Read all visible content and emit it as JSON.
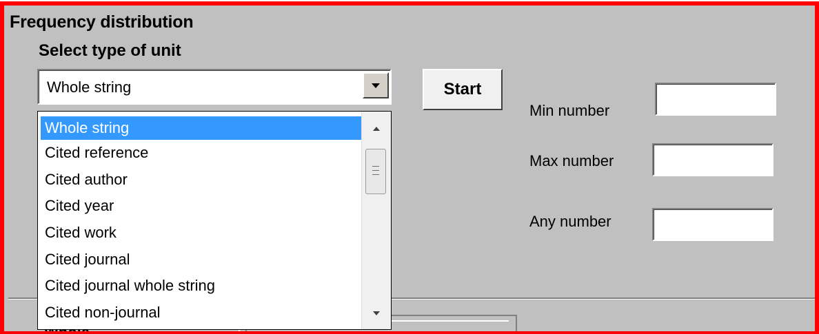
{
  "panel": {
    "title": "Frequency distribution",
    "subtitle": "Select type of unit",
    "lower_label": "Whole"
  },
  "combo": {
    "value": "Whole string"
  },
  "dropdown": {
    "items": [
      "Whole string",
      "Cited reference",
      "Cited author",
      "Cited year",
      "Cited work",
      "Cited journal",
      "Cited journal whole string",
      "Cited non-journal"
    ],
    "selected_index": 0
  },
  "start_button": {
    "label": "Start"
  },
  "fields": {
    "min_label": "Min number",
    "min_value": "",
    "max_label": "Max number",
    "max_value": "",
    "any_label": "Any number",
    "any_value": ""
  },
  "colors": {
    "frame_border": "#ff0000",
    "panel_bg": "#c0c0c0",
    "selection": "#3399ff"
  }
}
